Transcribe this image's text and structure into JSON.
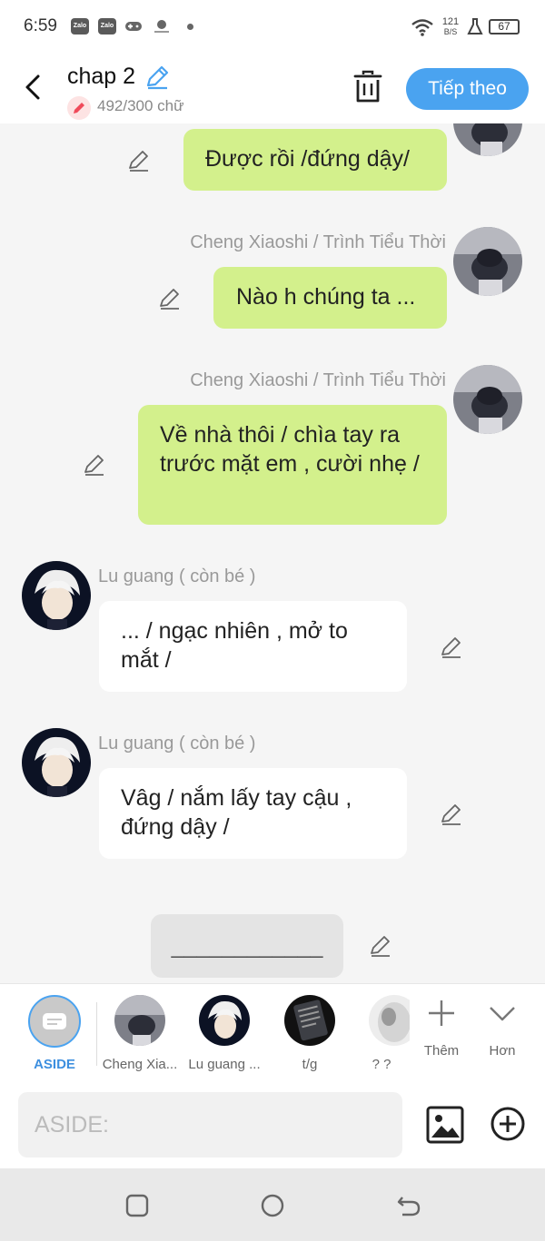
{
  "status_bar": {
    "time": "6:59",
    "app_icons": [
      "Zalo",
      "Zalo"
    ],
    "network_speed_top": "121",
    "network_speed_bottom": "B/S",
    "battery": "67"
  },
  "header": {
    "title": "chap 2",
    "word_count": "492/300 chữ",
    "next_button": "Tiếp theo"
  },
  "messages": [
    {
      "side": "right",
      "sender": "",
      "text": "Được rồi /đứng dậy/"
    },
    {
      "side": "right",
      "sender": "Cheng Xiaoshi / Trình Tiểu Thời",
      "text": "Nào h chúng ta ..."
    },
    {
      "side": "right",
      "sender": "Cheng Xiaoshi / Trình Tiểu Thời",
      "text": "Về nhà thôi / chìa tay ra trước mặt em , cười nhẹ /"
    },
    {
      "side": "left",
      "sender": "Lu guang ( còn bé )",
      "text": "... / ngạc nhiên , mở to mắt /"
    },
    {
      "side": "left",
      "sender": "Lu guang ( còn bé )",
      "text": "Vâg / nắm lấy tay cậu , đứng dậy /"
    },
    {
      "side": "center",
      "sender": "",
      "text": "____________"
    }
  ],
  "toolbar": {
    "aside_label": "ASIDE",
    "characters": [
      {
        "label": "Cheng Xia..."
      },
      {
        "label": "Lu guang ..."
      },
      {
        "label": "t/g"
      },
      {
        "label": "? ?"
      }
    ],
    "more_label": "Thêm",
    "expand_label": "Hơn"
  },
  "input": {
    "placeholder": "ASIDE:"
  },
  "colors": {
    "accent": "#4aa3f0",
    "bubble_green": "#d3f08c",
    "bubble_white": "#ffffff",
    "background": "#f5f5f5"
  },
  "icons": [
    "back-arrow-icon",
    "pencil-icon",
    "trash-icon",
    "image-icon",
    "add-circle-icon",
    "plus-icon",
    "chevron-down-icon"
  ]
}
